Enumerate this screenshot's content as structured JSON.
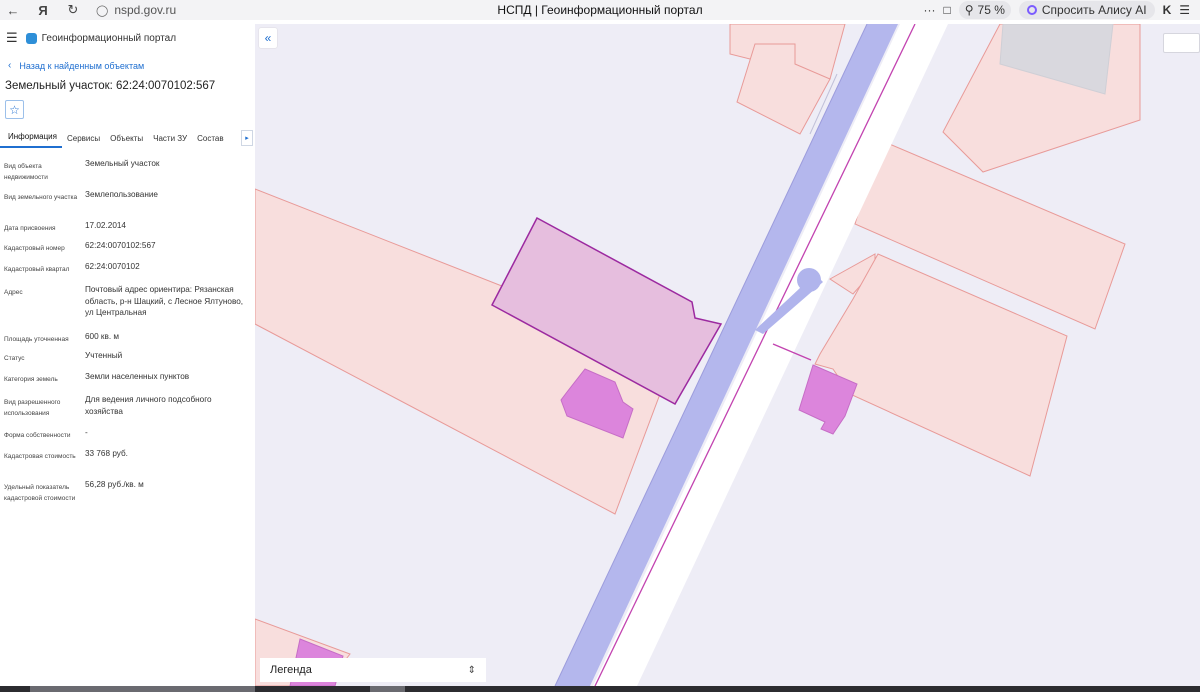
{
  "browser": {
    "url": "nspd.gov.ru",
    "tab_title": "НСПД | Геоинформационный портал",
    "zoom": "75 %",
    "alice_label": "Спросить Алису AI",
    "more_label": "···"
  },
  "sidebar": {
    "portal_name": "Геоинформационный портал",
    "back_link": "Назад к найденным объектам",
    "title": "Земельный участок: 62:24:0070102:567",
    "tabs": [
      "Информация",
      "Сервисы",
      "Объекты",
      "Части ЗУ",
      "Состав"
    ],
    "properties": [
      {
        "label": "Вид объекта недвижимости",
        "value": "Земельный участок"
      },
      {
        "label": "Вид земельного участка",
        "value": "Землепользование"
      },
      {
        "label": "Дата присвоения",
        "value": "17.02.2014"
      },
      {
        "label": "Кадастровый номер",
        "value": "62:24:0070102:567"
      },
      {
        "label": "Кадастровый квартал",
        "value": "62:24:0070102"
      },
      {
        "label": "Адрес",
        "value": "Почтовый адрес ориентира: Рязанская область, р-н Шацкий, с Лесное Ялтуново, ул Центральная"
      },
      {
        "label": "Площадь уточненная",
        "value": "600 кв. м"
      },
      {
        "label": "Статус",
        "value": "Учтенный"
      },
      {
        "label": "Категория земель",
        "value": "Земли населенных пунктов"
      },
      {
        "label": "Вид разрешенного использования",
        "value": "Для ведения личного подсобного хозяйства"
      },
      {
        "label": "Форма собственности",
        "value": "-"
      },
      {
        "label": "Кадастровая стоимость",
        "value": "33 768 руб."
      },
      {
        "label": "Удельный показатель кадастровой стоимости",
        "value": "56,28 руб./кв. м"
      }
    ]
  },
  "map": {
    "legend_label": "Легенда",
    "colors": {
      "background": "#eeedf6",
      "parcel_fill": "#f8dedd",
      "parcel_stroke": "#e89a98",
      "selected_fill": "#e6bede",
      "selected_stroke": "#9c2aa0",
      "building_fill": "#dc85dc",
      "road_blue": "#b0b4ec",
      "road_white": "#ffffff"
    }
  }
}
